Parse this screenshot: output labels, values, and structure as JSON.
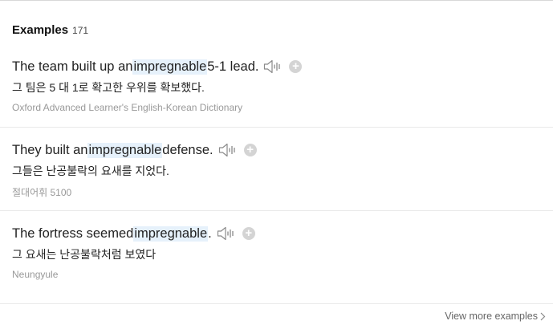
{
  "section": {
    "title": "Examples",
    "count": "171"
  },
  "examples": [
    {
      "en_before": "The team built up an ",
      "en_highlight": "impregnable",
      "en_after": " 5-1 lead.",
      "ko": "그 팀은 5 대 1로 확고한 우위를 확보했다.",
      "source": "Oxford Advanced Learner's English-Korean Dictionary"
    },
    {
      "en_before": "They built an ",
      "en_highlight": "impregnable",
      "en_after": " defense.",
      "ko": "그들은 난공불락의 요새를 지었다.",
      "source": "절대어휘 5100"
    },
    {
      "en_before": "The fortress seemed ",
      "en_highlight": "impregnable",
      "en_after": ".",
      "ko": "그 요새는 난공불락처럼 보였다",
      "source": "Neungyule"
    }
  ],
  "footer": {
    "view_more": "View more examples"
  },
  "colors": {
    "highlight_bg": "#e6f1fb",
    "source_text": "#999999",
    "plus_bg": "#d4d4d4"
  },
  "icons": {
    "speaker": "speaker-icon",
    "add": "plus-icon",
    "chevron": "chevron-right-icon"
  }
}
